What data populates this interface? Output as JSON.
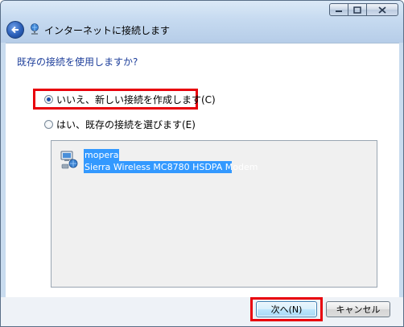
{
  "window": {
    "title": "インターネットに接続します"
  },
  "content": {
    "question": "既存の接続を使用しますか?",
    "options": [
      {
        "label": "いいえ、新しい接続を作成します(C)",
        "checked": true
      },
      {
        "label": "はい、既存の接続を選びます(E)",
        "checked": false
      }
    ],
    "connections": [
      {
        "name": "mopera",
        "device": "Sierra Wireless MC8780 HSDPA Modem"
      }
    ]
  },
  "footer": {
    "next_label": "次へ(N)",
    "cancel_label": "キャンセル"
  },
  "colors": {
    "highlight": "#e8000b",
    "selection": "#3399ff",
    "question_text": "#1e3f9b"
  },
  "icons": {
    "back": "back-arrow-icon",
    "title": "network-icon",
    "connection": "dialup-connection-icon",
    "minimize": "minimize-icon",
    "maximize": "maximize-icon",
    "close": "close-icon"
  }
}
